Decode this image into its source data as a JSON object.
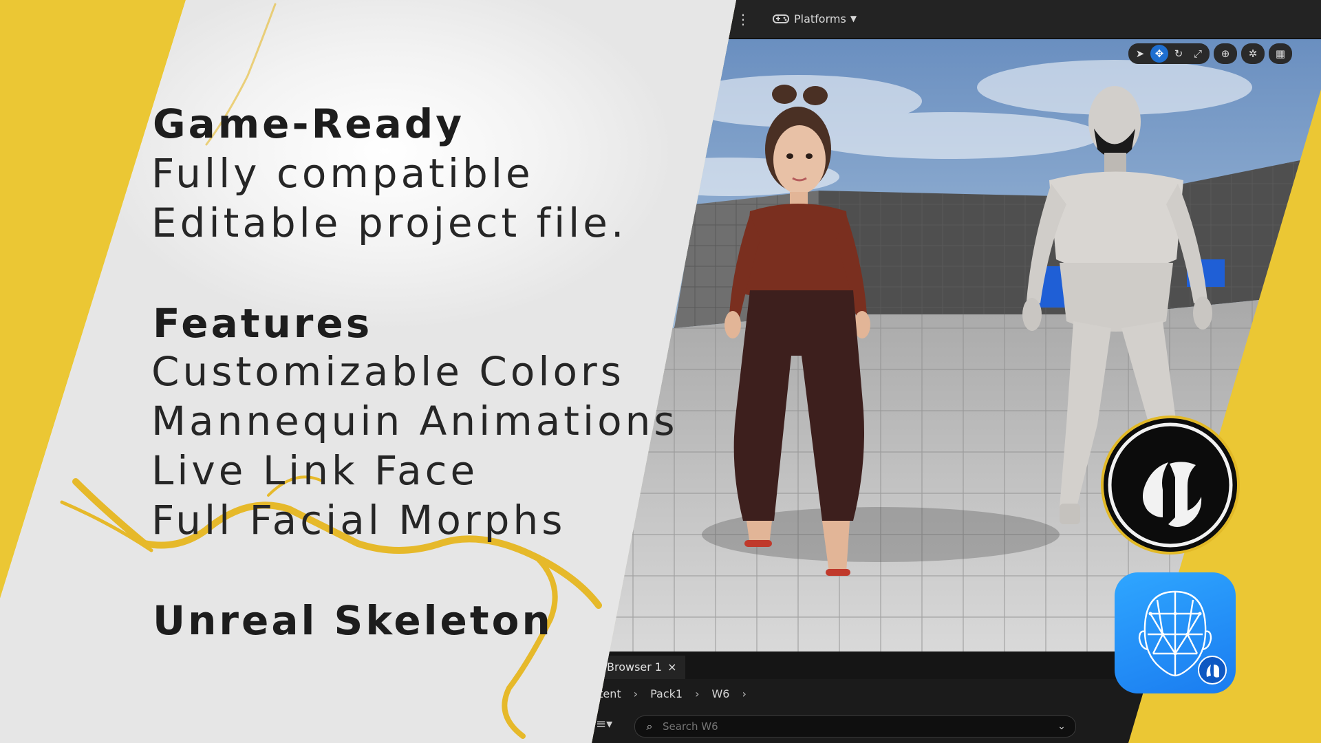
{
  "headline": {
    "title": "Game-Ready",
    "lines": [
      "Fully compatible",
      "Editable project file."
    ]
  },
  "features": {
    "title": "Features",
    "items": [
      "Customizable Colors",
      "Mannequin Animations",
      "Live Link Face",
      "Full Facial Morphs"
    ]
  },
  "skeleton_label": "Unreal Skeleton",
  "editor": {
    "menu_icon": "kebab-menu-icon",
    "platforms_label": "Platforms",
    "viewport_tools": [
      "select-icon",
      "translate-icon",
      "rotate-icon",
      "scale-icon",
      "surface-snap-icon",
      "world-local-icon",
      "grid-snap-icon"
    ],
    "content_browser": {
      "tab_label": "Browser 1",
      "tab_close": "×",
      "breadcrumb": [
        "ntent",
        "Pack1",
        "W6"
      ],
      "search_placeholder": "Search W6"
    }
  },
  "logos": {
    "unreal_engine": "unreal-engine-logo",
    "live_link_face": "live-link-face-app-icon"
  },
  "colors": {
    "background_yellow": "#ebc734",
    "accent_blue": "#1f6fd0",
    "text_dark": "#1d1d1d"
  }
}
